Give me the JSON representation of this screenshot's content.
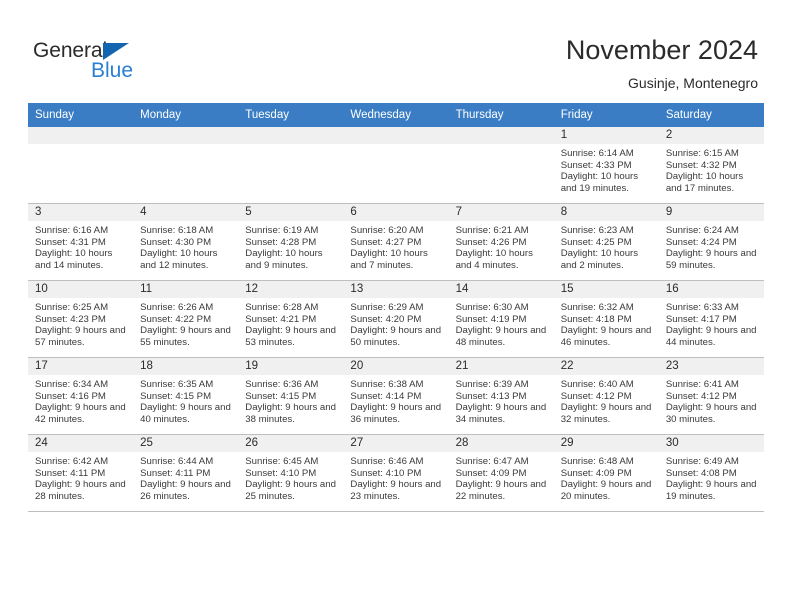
{
  "brand": {
    "name_part1": "General",
    "name_part2": "Blue",
    "accent_color": "#2a7fd4",
    "logo_triangle_color": "#1465b0"
  },
  "header": {
    "title": "November 2024",
    "subtitle": "Gusinje, Montenegro"
  },
  "theme": {
    "header_row_bg": "#3a7dc4",
    "daynum_band_bg": "#f0f0f0",
    "cell_border": "#bfbfbf",
    "text_color": "#2b2b2b"
  },
  "weekday_headers": [
    "Sunday",
    "Monday",
    "Tuesday",
    "Wednesday",
    "Thursday",
    "Friday",
    "Saturday"
  ],
  "weeks": [
    [
      {
        "empty": true
      },
      {
        "empty": true
      },
      {
        "empty": true
      },
      {
        "empty": true
      },
      {
        "empty": true
      },
      {
        "empty": false,
        "day": "1",
        "sunrise": "Sunrise: 6:14 AM",
        "sunset": "Sunset: 4:33 PM",
        "daylight": "Daylight: 10 hours and 19 minutes."
      },
      {
        "empty": false,
        "day": "2",
        "sunrise": "Sunrise: 6:15 AM",
        "sunset": "Sunset: 4:32 PM",
        "daylight": "Daylight: 10 hours and 17 minutes."
      }
    ],
    [
      {
        "empty": false,
        "day": "3",
        "sunrise": "Sunrise: 6:16 AM",
        "sunset": "Sunset: 4:31 PM",
        "daylight": "Daylight: 10 hours and 14 minutes."
      },
      {
        "empty": false,
        "day": "4",
        "sunrise": "Sunrise: 6:18 AM",
        "sunset": "Sunset: 4:30 PM",
        "daylight": "Daylight: 10 hours and 12 minutes."
      },
      {
        "empty": false,
        "day": "5",
        "sunrise": "Sunrise: 6:19 AM",
        "sunset": "Sunset: 4:28 PM",
        "daylight": "Daylight: 10 hours and 9 minutes."
      },
      {
        "empty": false,
        "day": "6",
        "sunrise": "Sunrise: 6:20 AM",
        "sunset": "Sunset: 4:27 PM",
        "daylight": "Daylight: 10 hours and 7 minutes."
      },
      {
        "empty": false,
        "day": "7",
        "sunrise": "Sunrise: 6:21 AM",
        "sunset": "Sunset: 4:26 PM",
        "daylight": "Daylight: 10 hours and 4 minutes."
      },
      {
        "empty": false,
        "day": "8",
        "sunrise": "Sunrise: 6:23 AM",
        "sunset": "Sunset: 4:25 PM",
        "daylight": "Daylight: 10 hours and 2 minutes."
      },
      {
        "empty": false,
        "day": "9",
        "sunrise": "Sunrise: 6:24 AM",
        "sunset": "Sunset: 4:24 PM",
        "daylight": "Daylight: 9 hours and 59 minutes."
      }
    ],
    [
      {
        "empty": false,
        "day": "10",
        "sunrise": "Sunrise: 6:25 AM",
        "sunset": "Sunset: 4:23 PM",
        "daylight": "Daylight: 9 hours and 57 minutes."
      },
      {
        "empty": false,
        "day": "11",
        "sunrise": "Sunrise: 6:26 AM",
        "sunset": "Sunset: 4:22 PM",
        "daylight": "Daylight: 9 hours and 55 minutes."
      },
      {
        "empty": false,
        "day": "12",
        "sunrise": "Sunrise: 6:28 AM",
        "sunset": "Sunset: 4:21 PM",
        "daylight": "Daylight: 9 hours and 53 minutes."
      },
      {
        "empty": false,
        "day": "13",
        "sunrise": "Sunrise: 6:29 AM",
        "sunset": "Sunset: 4:20 PM",
        "daylight": "Daylight: 9 hours and 50 minutes."
      },
      {
        "empty": false,
        "day": "14",
        "sunrise": "Sunrise: 6:30 AM",
        "sunset": "Sunset: 4:19 PM",
        "daylight": "Daylight: 9 hours and 48 minutes."
      },
      {
        "empty": false,
        "day": "15",
        "sunrise": "Sunrise: 6:32 AM",
        "sunset": "Sunset: 4:18 PM",
        "daylight": "Daylight: 9 hours and 46 minutes."
      },
      {
        "empty": false,
        "day": "16",
        "sunrise": "Sunrise: 6:33 AM",
        "sunset": "Sunset: 4:17 PM",
        "daylight": "Daylight: 9 hours and 44 minutes."
      }
    ],
    [
      {
        "empty": false,
        "day": "17",
        "sunrise": "Sunrise: 6:34 AM",
        "sunset": "Sunset: 4:16 PM",
        "daylight": "Daylight: 9 hours and 42 minutes."
      },
      {
        "empty": false,
        "day": "18",
        "sunrise": "Sunrise: 6:35 AM",
        "sunset": "Sunset: 4:15 PM",
        "daylight": "Daylight: 9 hours and 40 minutes."
      },
      {
        "empty": false,
        "day": "19",
        "sunrise": "Sunrise: 6:36 AM",
        "sunset": "Sunset: 4:15 PM",
        "daylight": "Daylight: 9 hours and 38 minutes."
      },
      {
        "empty": false,
        "day": "20",
        "sunrise": "Sunrise: 6:38 AM",
        "sunset": "Sunset: 4:14 PM",
        "daylight": "Daylight: 9 hours and 36 minutes."
      },
      {
        "empty": false,
        "day": "21",
        "sunrise": "Sunrise: 6:39 AM",
        "sunset": "Sunset: 4:13 PM",
        "daylight": "Daylight: 9 hours and 34 minutes."
      },
      {
        "empty": false,
        "day": "22",
        "sunrise": "Sunrise: 6:40 AM",
        "sunset": "Sunset: 4:12 PM",
        "daylight": "Daylight: 9 hours and 32 minutes."
      },
      {
        "empty": false,
        "day": "23",
        "sunrise": "Sunrise: 6:41 AM",
        "sunset": "Sunset: 4:12 PM",
        "daylight": "Daylight: 9 hours and 30 minutes."
      }
    ],
    [
      {
        "empty": false,
        "day": "24",
        "sunrise": "Sunrise: 6:42 AM",
        "sunset": "Sunset: 4:11 PM",
        "daylight": "Daylight: 9 hours and 28 minutes."
      },
      {
        "empty": false,
        "day": "25",
        "sunrise": "Sunrise: 6:44 AM",
        "sunset": "Sunset: 4:11 PM",
        "daylight": "Daylight: 9 hours and 26 minutes."
      },
      {
        "empty": false,
        "day": "26",
        "sunrise": "Sunrise: 6:45 AM",
        "sunset": "Sunset: 4:10 PM",
        "daylight": "Daylight: 9 hours and 25 minutes."
      },
      {
        "empty": false,
        "day": "27",
        "sunrise": "Sunrise: 6:46 AM",
        "sunset": "Sunset: 4:10 PM",
        "daylight": "Daylight: 9 hours and 23 minutes."
      },
      {
        "empty": false,
        "day": "28",
        "sunrise": "Sunrise: 6:47 AM",
        "sunset": "Sunset: 4:09 PM",
        "daylight": "Daylight: 9 hours and 22 minutes."
      },
      {
        "empty": false,
        "day": "29",
        "sunrise": "Sunrise: 6:48 AM",
        "sunset": "Sunset: 4:09 PM",
        "daylight": "Daylight: 9 hours and 20 minutes."
      },
      {
        "empty": false,
        "day": "30",
        "sunrise": "Sunrise: 6:49 AM",
        "sunset": "Sunset: 4:08 PM",
        "daylight": "Daylight: 9 hours and 19 minutes."
      }
    ]
  ]
}
